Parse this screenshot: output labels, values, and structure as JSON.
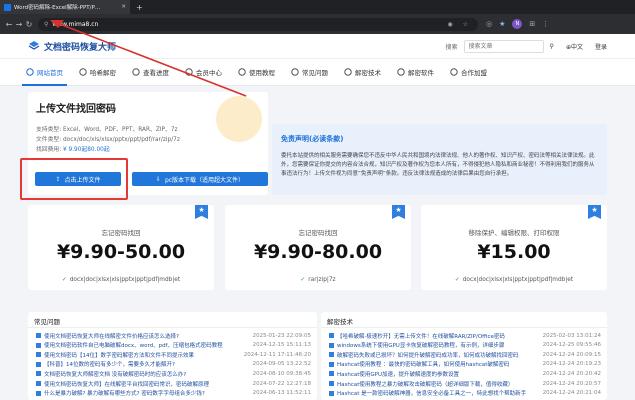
{
  "browser": {
    "tab_title": "Word密码解除-Excel解除-PPT/P…",
    "url_domain": "www.mima8.cn",
    "profile_initial": "N"
  },
  "header": {
    "site_name": "文档密码恢复大师",
    "search_button": "搜索",
    "search_placeholder": "搜索文章",
    "lang_label": "中文",
    "login_label": "登录",
    "brand_color": "#1e6fd9"
  },
  "menu": {
    "items": [
      {
        "label": "网站首页",
        "icon": "home-icon"
      },
      {
        "label": "哈希解密",
        "icon": "key-icon"
      },
      {
        "label": "查看进度",
        "icon": "progress-icon"
      },
      {
        "label": "会员中心",
        "icon": "user-icon"
      },
      {
        "label": "使用教程",
        "icon": "book-icon"
      },
      {
        "label": "常见问题",
        "icon": "question-icon"
      },
      {
        "label": "解密技术",
        "icon": "tech-icon"
      },
      {
        "label": "解密软件",
        "icon": "software-icon"
      },
      {
        "label": "合作加盟",
        "icon": "handshake-icon"
      }
    ],
    "active_index": 0
  },
  "upload": {
    "title": "上传文件找回密码",
    "formats_label": "支持类型:",
    "formats_value": "Excel、Word、PDF、PPT、RAR、ZIP、7z",
    "ext_label": "文件类型:",
    "ext_value": "docx/doc/xls/xlsx/pptx/ppt/pdf/rar/zip/7z",
    "price_label": "找回费用:",
    "price_value": "¥ 9.90起80.00起",
    "upload_button": "点击上传文件",
    "pc_button": "pc版本下载（适用超大文件）"
  },
  "disclaimer": {
    "title": "免责声明(必读条款)",
    "body": "委托本站提供的相关服务需要确保您不违反中华人民共和国境内法律法规、他人的著作权、知识产权、密码法等相关法律法规。此外，您需要保证你提交的内容合法合规，知识产权及著作权为您本人所有，不得侵犯他人隐私和商业秘密！不得利用我们的服务从事违法行为！上传文件视为同意”免责声明”条款。违反法律法规造成的法律后果由您自行承担。"
  },
  "pricing": [
    {
      "name": "忘记密码找回",
      "price": "¥9.90-50.00",
      "formats": "docx|doc|xlsx|xls|pptx|ppt|pdf|mdb|et",
      "ribbon": "★"
    },
    {
      "name": "忘记密码找回",
      "price": "¥9.90-80.00",
      "formats": "rar|zip|7z",
      "ribbon": "★"
    },
    {
      "name": "移除保护、编辑权限、打印权限",
      "price": "¥15.00",
      "formats": "docx|doc|xlsx|xls|pptx|ppt|pdf|mdb|et",
      "ribbon": "★"
    }
  ],
  "faq": {
    "title": "常见问题",
    "rows": [
      {
        "text": "使用文档密码恢复大师在线解密文件价格应该怎么选择?",
        "date": "2025-01-23 22:09:05"
      },
      {
        "text": "使用文档密码软件自已电脑破解docx、word、pdf、压缩包格式密码教程",
        "date": "2024-12-15 15:11:13"
      },
      {
        "text": "使用文档密码【14位】数字密码解密方法和文件不同提示效果",
        "date": "2024-12-11 17:11:46:20"
      },
      {
        "text": "【科普】14位数的密码有多少个，需要多久才能解开?",
        "date": "2024-09-05 13:22:52"
      },
      {
        "text": "文档密码恢复大师解密文档 没有破解密码时的应该怎么办?",
        "date": "2024-08-10 09:38:45"
      },
      {
        "text": "使用文档密码恢复大师】在线解密平台找回密码常识，密码破解原理",
        "date": "2024-07-22 12:27:18"
      },
      {
        "text": "什么是暴力破解? 暴力破解有哪些方式? 密码数字字母组合多少钱?",
        "date": "2024-06-13 11:52:11"
      }
    ]
  },
  "tech": {
    "title": "解密技术",
    "rows": [
      {
        "text": "【哈希破解·极速秒开】无需上传文件！在线破解RAR/ZIP/Office密码",
        "date": "2025-02-03 13:01:24"
      },
      {
        "text": "windows系统下使用GPU显卡恢复破解密码教程，有示例，详细步骤",
        "date": "2024-12-25 09:55:46"
      },
      {
        "text": "破解密码失败或已损坏？如何提升破解密码成功率，如何成功破解找回密码",
        "date": "2024-12-24 20:09:15"
      },
      {
        "text": "Hashcat使用教程 ：最快的密码破解工具，如何使用hashcat破解密码",
        "date": "2024-12-24 20:19:23"
      },
      {
        "text": "Hashcat使用GPU加速，提升破解速度的参数设置",
        "date": "2024-12-24 20:20:42"
      },
      {
        "text": "Hashcat使用教程之暴力破解攻击破解密码（超详细版下载，值得收藏）",
        "date": "2024-12-24 20:20:57"
      },
      {
        "text": "Hashcat 是一款密码破解神器，信息安全必备工具之一，特此想找个帮助新手",
        "date": "2024-12-24 20:21:04"
      }
    ]
  }
}
